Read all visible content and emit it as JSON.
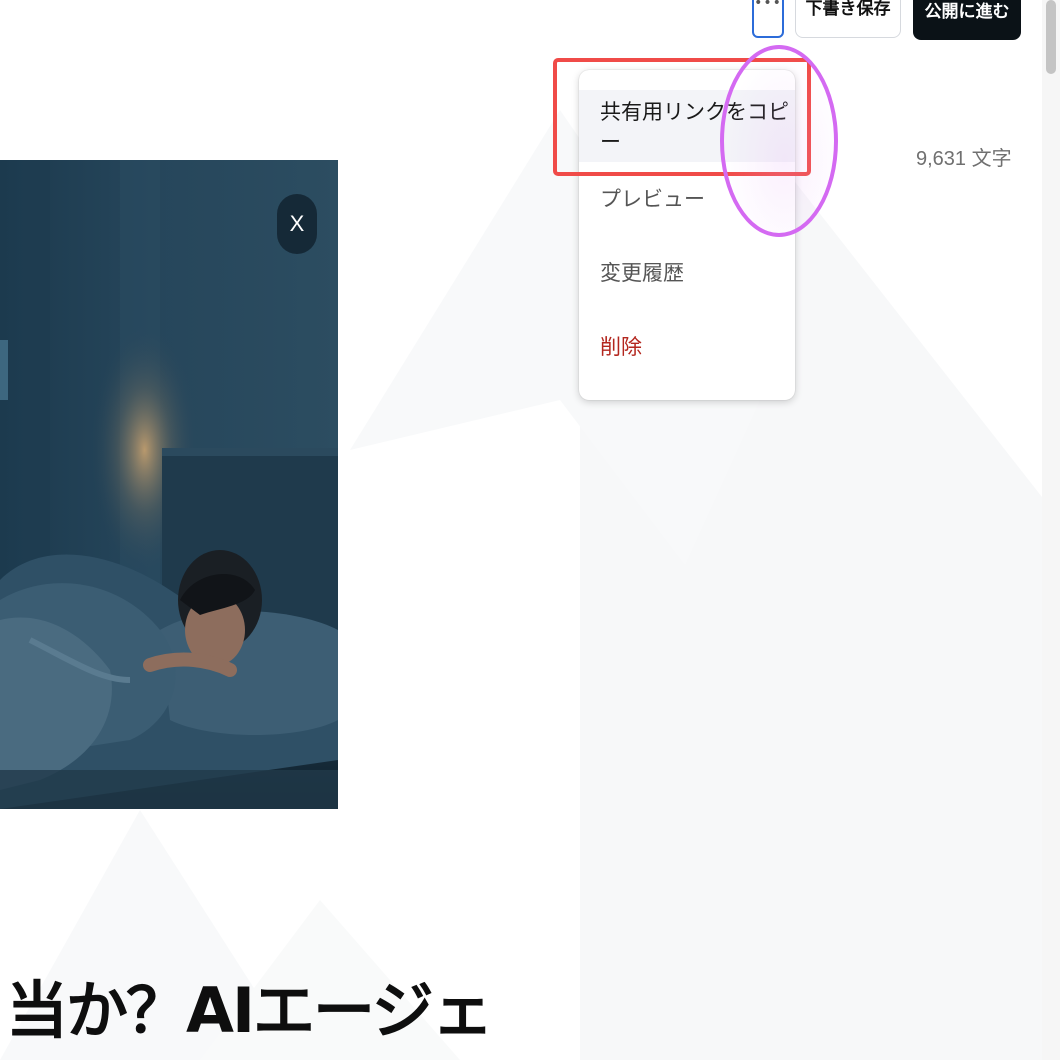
{
  "toolbar": {
    "more_icon": "•••",
    "draft_save_label": "下書き保存",
    "publish_label": "公開に進む"
  },
  "editor": {
    "char_count": "9,631 文字",
    "image_close_label": "X",
    "heading_text": "当か？AIエージェ"
  },
  "menu": {
    "items": [
      {
        "label": "共有用リンクをコピー",
        "state": "hovered"
      },
      {
        "label": "プレビュー"
      },
      {
        "label": "変更履歴"
      },
      {
        "label": "削除",
        "color": "#b3261e"
      }
    ]
  },
  "colors": {
    "publish_bg": "#0b1217",
    "delete_text": "#b3261e",
    "highlight_box": "#f04b48",
    "cursor_ring": "#d46af2",
    "focus_border": "#2c6cd9"
  },
  "image": {
    "subject": "person sleeping in a dark blue bedroom"
  }
}
